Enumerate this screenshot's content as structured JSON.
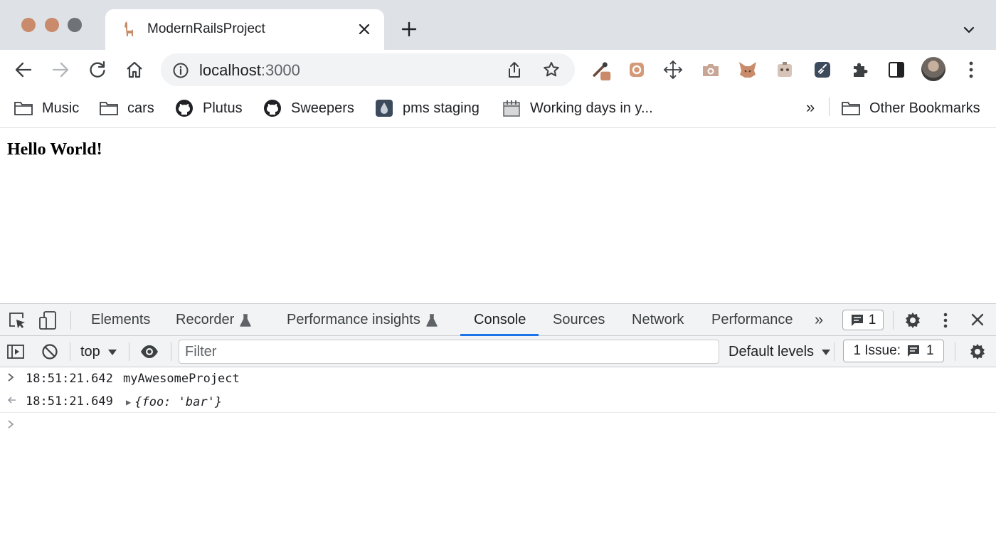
{
  "browser": {
    "tab": {
      "title": "ModernRailsProject"
    },
    "address": {
      "host": "localhost",
      "port": ":3000"
    },
    "bookmarks": [
      {
        "label": "Music",
        "icon": "folder-icon"
      },
      {
        "label": "cars",
        "icon": "folder-icon"
      },
      {
        "label": "Plutus",
        "icon": "github-icon"
      },
      {
        "label": "Sweepers",
        "icon": "github-icon"
      },
      {
        "label": "pms staging",
        "icon": "drop-icon"
      },
      {
        "label": "Working days in y...",
        "icon": "calendar-icon"
      }
    ],
    "bookmarks_more": "»",
    "other_bookmarks": "Other Bookmarks"
  },
  "page": {
    "heading": "Hello World!"
  },
  "devtools": {
    "tabs": [
      {
        "label": "Elements"
      },
      {
        "label": "Recorder"
      },
      {
        "label": "Performance insights"
      },
      {
        "label": "Console"
      },
      {
        "label": "Sources"
      },
      {
        "label": "Network"
      },
      {
        "label": "Performance"
      }
    ],
    "more_tabs": "»",
    "messages_badge": "1",
    "context": "top",
    "filter_placeholder": "Filter",
    "levels": "Default levels",
    "issues_label": "1 Issue:",
    "issues_count": "1",
    "console_rows": [
      {
        "timestamp": "18:51:21.642",
        "message": "myAwesomeProject"
      },
      {
        "timestamp": "18:51:21.649",
        "obj_open": "{foo: ",
        "obj_value": "'bar'",
        "obj_close": "}"
      }
    ]
  },
  "colors": {
    "accent": "#1a73e8",
    "traffic_red": "#c98b6b",
    "traffic_yellow": "#c98b6b",
    "traffic_gray": "#6f7378"
  }
}
